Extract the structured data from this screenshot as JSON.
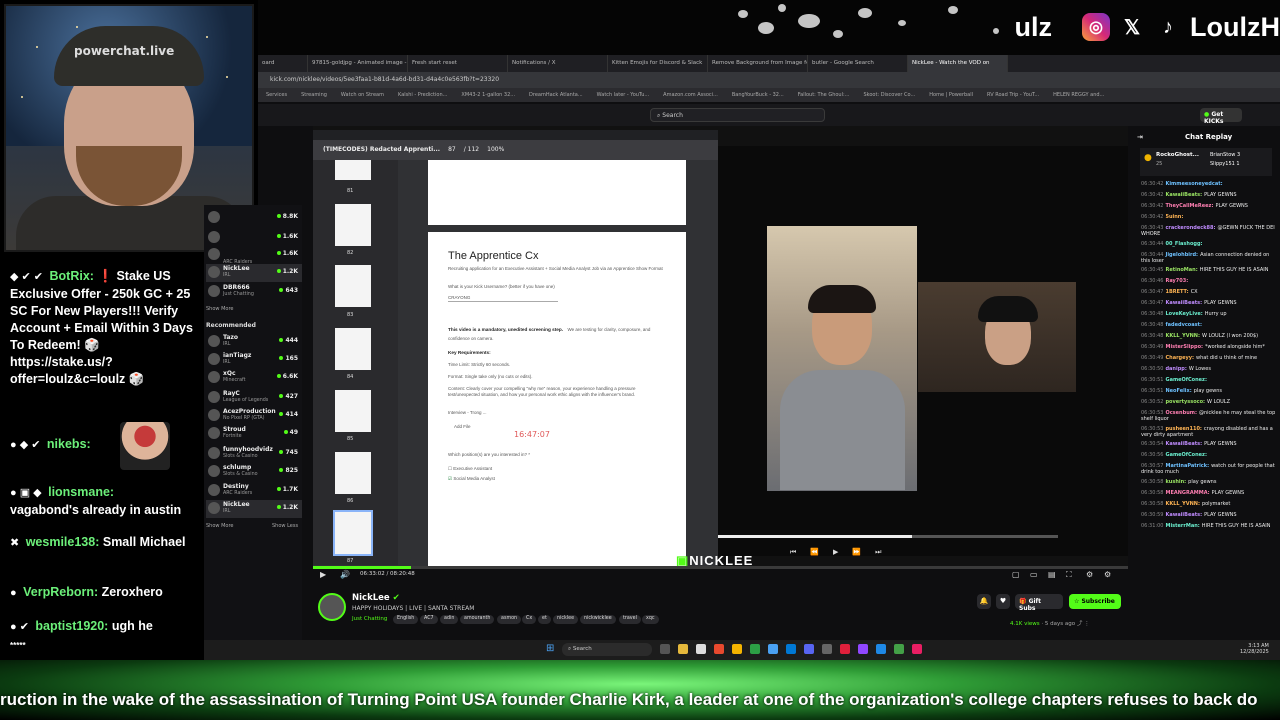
{
  "overlay": {
    "handle_partial": "ulz",
    "handle": "LoulzH",
    "social_icons": [
      "instagram-icon",
      "x-icon",
      "tiktok-icon"
    ],
    "accent": "#53fc18"
  },
  "webcam": {
    "cap_text": "powerchat.live"
  },
  "chat_overlay": {
    "messages": [
      {
        "user": "BotRix:",
        "badges": "◆ ✔ ✔",
        "text": "❗ Stake US Exclusive Offer - 250k GC + 25 SC For New Players!!! Verify Account + Email Within 3 Days To Redeem! 🎲 https://stake.us/?offer=loulz&c=loulz 🎲"
      },
      {
        "user": "nikebs:",
        "badges": "● ◆ ✔",
        "text": ""
      },
      {
        "user": "lionsmane:",
        "badges": "● ▣ ◆",
        "text": "vagabond's already in austin"
      },
      {
        "user": "wesmile138:",
        "badges": "✖",
        "text": "Small Michael"
      },
      {
        "user": "VerpReborn:",
        "badges": "●",
        "text": "Zeroxhero"
      },
      {
        "user": "baptist1920:",
        "badges": "● ✔",
        "text": "ugh he"
      }
    ],
    "trailing": "*****"
  },
  "browser": {
    "tabs": [
      "oard",
      "97815-goldjpg - Animated image -",
      "Fresh start reset",
      "Notifications / X",
      "Kitten Emojis for Discord & Slack",
      "Remove Background from Image fo",
      "butler - Google Search",
      "NickLee - Watch the VOD on"
    ],
    "url": "kick.com/nicklee/videos/5ee3faa1-b81d-4a6d-bd31-d4a4c0e563fb?t=23320",
    "bookmarks": [
      "Services",
      "Streaming",
      "Watch on Stream",
      "Kalshi - Prediction...",
      "XM43-2 1-gallon 32...",
      "DreamHack Atlanta...",
      "Watch later - YouTu...",
      "Amazon.com Associ...",
      "BangYourBuck - 32...",
      "Fallout: The Ghoul:...",
      "Skoot: Discover Co...",
      "Home | Powerball",
      "RV Road Trip - YouT...",
      "HELEN REGGY and..."
    ],
    "search_placeholder": "Search",
    "get_kicks": "Get KICKs"
  },
  "sidebar": {
    "following": [
      {
        "name": "",
        "sub": "",
        "count": "8.8K"
      },
      {
        "name": "",
        "sub": "",
        "count": "1.6K"
      },
      {
        "name": "",
        "sub": "",
        "count": "1.6K"
      },
      {
        "name": "",
        "sub": "ARC Raiders",
        "count": ""
      },
      {
        "name": "NickLee",
        "sub": "IRL",
        "count": "1.2K"
      },
      {
        "name": "DBR666",
        "sub": "Just Chatting",
        "count": "643"
      }
    ],
    "show_more": "Show More",
    "recommended_label": "Recommended",
    "recommended": [
      {
        "name": "Tazo",
        "sub": "IRL",
        "count": "444"
      },
      {
        "name": "ianTiagz",
        "sub": "IRL",
        "count": "165"
      },
      {
        "name": "xQc",
        "sub": "Minecraft",
        "count": "6.6K"
      },
      {
        "name": "RayC",
        "sub": "League of Legends",
        "count": "427"
      },
      {
        "name": "AcezProduction",
        "sub": "No Pixel RP (GTA)",
        "count": "414"
      },
      {
        "name": "Stroud",
        "sub": "Fortnite",
        "count": "49"
      },
      {
        "name": "funnyhoodvidz",
        "sub": "Slots & Casino",
        "count": "745"
      },
      {
        "name": "schlump",
        "sub": "Slots & Casino",
        "count": "825"
      },
      {
        "name": "Destiny",
        "sub": "ARC Raiders",
        "count": "1.7K"
      },
      {
        "name": "NickLee",
        "sub": "IRL",
        "count": "1.2K"
      }
    ],
    "show_more_2": "Show More",
    "show_less": "Show Less"
  },
  "doc": {
    "window_title": "(TIMECODES) Redacted Apprenti...",
    "page_current": "87",
    "page_total": "/ 112",
    "zoom": "100%",
    "thumb_numbers": [
      "81",
      "82",
      "83",
      "84",
      "85",
      "86",
      "87"
    ],
    "title": "The Apprentice Cx",
    "subtitle": "Recruiting application for an Executive Assistant + Social Media Analyst Job via an Apprentice Show Format",
    "q1": "What is your Kick Username? (better if you have one)",
    "q1_answer": "CRAYONG",
    "video_note": "This video is a mandatory, unedited screening step.",
    "video_note_rest": "We are testing for clarity, composure, and confidence on camera.",
    "key_req": "Key Requirements:",
    "time_limit": "Time Limit: Strictly 60 seconds.",
    "format": "Format: Single take only (no cuts or edits).",
    "content": "Content: Clearly cover your compelling \"why me\" reason, your experience handling a pressure test/unexpected situation, and how your personal work ethic aligns with the influencer's brand.",
    "file": "Interview - Trong ...",
    "add_file": "Add File",
    "timestamp": "16:47:07",
    "q2": "Which position(s) are you interested in? *",
    "opt1": "Executive Assistant",
    "opt2": "Social Media Analyst"
  },
  "player": {
    "time": "06:33:02 / 08:20:48",
    "progress": 0.12,
    "inner_progress": 0.57,
    "watermark": "NICKLEE"
  },
  "stream": {
    "channel": "NickLee",
    "title": "HAPPY HOLIDAYS | LIVE | SANTA STREAM",
    "category": "Just Chatting",
    "tags": [
      "English",
      "AC7",
      "adin",
      "amouranth",
      "asmon",
      "Cx",
      "et",
      "nicklee",
      "nickwicklee",
      "travel",
      "xqc"
    ],
    "views": "4.1K views",
    "ago": "5 days ago",
    "gift_subs": "Gift Subs",
    "subscribe": "Subscribe"
  },
  "replay": {
    "title": "Chat Replay",
    "pinned_user": "RockoGhost...",
    "pinned_sub": "25",
    "pinned_others": [
      "BrianStow 3",
      "Slippy151 1"
    ],
    "lines": [
      {
        "t": "06:30:42",
        "u": "Kimmeesoneyedcat:",
        "m": ""
      },
      {
        "t": "06:30:42",
        "u": "KawaiiBeats:",
        "m": "PLAY GEWNS"
      },
      {
        "t": "06:30:42",
        "u": "TheyCallMeReez:",
        "m": "PLAY GEWNS"
      },
      {
        "t": "06:30:42",
        "u": "5uinn:",
        "m": ""
      },
      {
        "t": "06:30:43",
        "u": "crackerondeck88:",
        "m": "@GEWN FUCK THE DEI WHORE"
      },
      {
        "t": "06:30:44",
        "u": "00_Flashogg:",
        "m": ""
      },
      {
        "t": "06:30:44",
        "u": "Jigelohbird:",
        "m": "Asian connection denied on this loser"
      },
      {
        "t": "06:30:45",
        "u": "RetinoMan:",
        "m": "HIRE THIS GUY HE IS ASAIN"
      },
      {
        "t": "06:30:46",
        "u": "Ray703:",
        "m": ""
      },
      {
        "t": "06:30:47",
        "u": "1BRETT:",
        "m": "CX"
      },
      {
        "t": "06:30:47",
        "u": "KawaiiBeats:",
        "m": "PLAY GEWNS"
      },
      {
        "t": "06:30:48",
        "u": "LoveKeyLive:",
        "m": "Hurry up"
      },
      {
        "t": "06:30:48",
        "u": "fadedvcoast:",
        "m": ""
      },
      {
        "t": "06:30:48",
        "u": "KKLL_YVNN:",
        "m": "W LOULZ (I won 200$)"
      },
      {
        "t": "06:30:49",
        "u": "MisterSlippo:",
        "m": "*worked alongside him*"
      },
      {
        "t": "06:30:49",
        "u": "Chargeyy:",
        "m": "what did u think of mine"
      },
      {
        "t": "06:30:50",
        "u": "danipp:",
        "m": "W Lowes"
      },
      {
        "t": "06:30:51",
        "u": "GameOfConez:",
        "m": ""
      },
      {
        "t": "06:30:51",
        "u": "NeoFelix:",
        "m": "play gewns"
      },
      {
        "t": "06:30:52",
        "u": "povertyssoco:",
        "m": "W LOULZ"
      },
      {
        "t": "06:30:53",
        "u": "Ocsenbum:",
        "m": "@nicklee he may steal the top shelf liquor"
      },
      {
        "t": "06:30:53",
        "u": "pusheen110:",
        "m": "crayong disabled and has a very dirty apartment"
      },
      {
        "t": "06:30:54",
        "u": "KawaiiBeats:",
        "m": "PLAY GEWNS"
      },
      {
        "t": "06:30:56",
        "u": "GameOfConez:",
        "m": ""
      },
      {
        "t": "06:30:57",
        "u": "MartinaPatrick:",
        "m": "watch out for people that drink too much"
      },
      {
        "t": "06:30:58",
        "u": "kushin:",
        "m": "play gewns"
      },
      {
        "t": "06:30:58",
        "u": "MEANGRAMMA:",
        "m": "PLAY GEWNS"
      },
      {
        "t": "06:30:58",
        "u": "KKLL_YVNN:",
        "m": "polymarket"
      },
      {
        "t": "06:30:59",
        "u": "KawaiiBeats:",
        "m": "PLAY GEWNS"
      },
      {
        "t": "06:31:00",
        "u": "MisterrMan:",
        "m": "HIRE THIS GUY HE IS ASAIN"
      }
    ]
  },
  "taskbar": {
    "search": "Search",
    "time": "3:13 AM",
    "date": "12/28/2025"
  },
  "ticker": {
    "text": "ruction in the wake of the assassination of Turning Point USA founder Charlie Kirk, a leader at one of the organization's college chapters refuses to back do"
  }
}
